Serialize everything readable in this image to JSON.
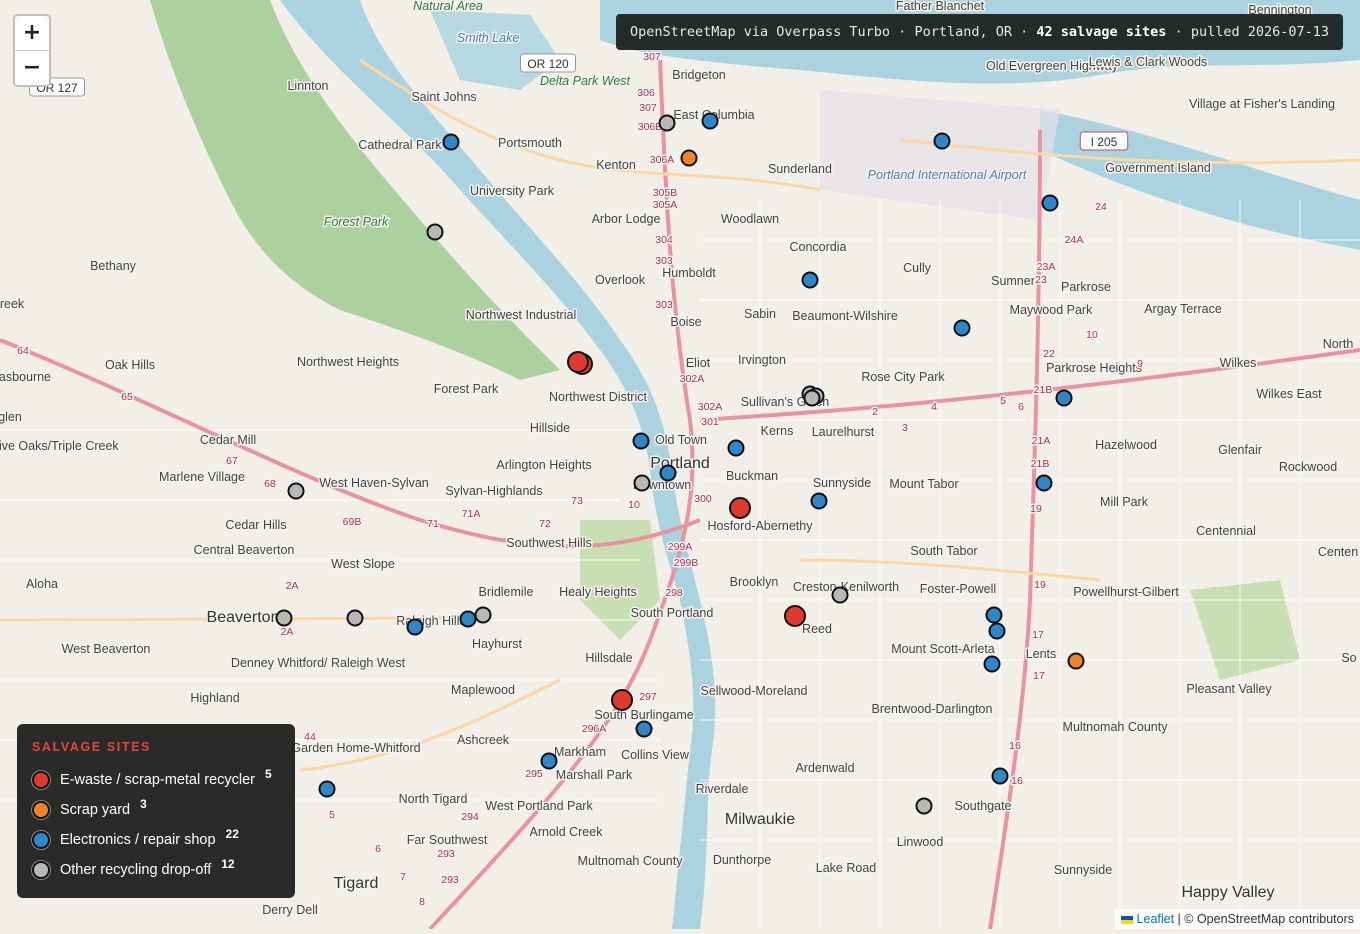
{
  "map": {
    "zoom_in_label": "+",
    "zoom_out_label": "−",
    "place_labels": [
      {
        "text": "Father Blanchet",
        "kind": "place"
      },
      {
        "text": "Bennington",
        "kind": "place"
      },
      {
        "text": "Old Evergreen Highway",
        "kind": "place"
      },
      {
        "text": "Lewis & Clark Woods",
        "kind": "place"
      },
      {
        "text": "Village at Fisher's Landing",
        "kind": "place"
      },
      {
        "text": "Linnton",
        "kind": "place"
      },
      {
        "text": "Saint Johns",
        "kind": "place"
      },
      {
        "text": "Bridgeton",
        "kind": "place"
      },
      {
        "text": "East Columbia",
        "kind": "place"
      },
      {
        "text": "Cathedral Park",
        "kind": "place"
      },
      {
        "text": "Portsmouth",
        "kind": "place"
      },
      {
        "text": "Kenton",
        "kind": "place"
      },
      {
        "text": "Sunderland",
        "kind": "place"
      },
      {
        "text": "University Park",
        "kind": "place"
      },
      {
        "text": "Arbor Lodge",
        "kind": "place"
      },
      {
        "text": "Woodlawn",
        "kind": "place"
      },
      {
        "text": "Concordia",
        "kind": "place"
      },
      {
        "text": "Cully",
        "kind": "place"
      },
      {
        "text": "Sumner",
        "kind": "place"
      },
      {
        "text": "Parkrose",
        "kind": "place"
      },
      {
        "text": "Argay Terrace",
        "kind": "place"
      },
      {
        "text": "Maywood Park",
        "kind": "place"
      },
      {
        "text": "Bethany",
        "kind": "place"
      },
      {
        "text": "Overlook",
        "kind": "place"
      },
      {
        "text": "Humboldt",
        "kind": "place"
      },
      {
        "text": "Boise",
        "kind": "place"
      },
      {
        "text": "Sabin",
        "kind": "place"
      },
      {
        "text": "Beaumont-Wilshire",
        "kind": "place"
      },
      {
        "text": "Northwest Industrial",
        "kind": "place"
      },
      {
        "text": "Northwest Heights",
        "kind": "place"
      },
      {
        "text": "Oak Hills",
        "kind": "place"
      },
      {
        "text": "Eliot",
        "kind": "place"
      },
      {
        "text": "Irvington",
        "kind": "place"
      },
      {
        "text": "Rose City Park",
        "kind": "place"
      },
      {
        "text": "Parkrose Heights",
        "kind": "place"
      },
      {
        "text": "Wilkes",
        "kind": "place"
      },
      {
        "text": "North",
        "kind": "place"
      },
      {
        "text": "Forest Park",
        "kind": "place"
      },
      {
        "text": "Northwest District",
        "kind": "place"
      },
      {
        "text": "Sullivan's Gulch",
        "kind": "place"
      },
      {
        "text": "Wilkes East",
        "kind": "place"
      },
      {
        "text": "Cedar Mill",
        "kind": "place"
      },
      {
        "text": "Five Oaks/Triple Creek",
        "kind": "place"
      },
      {
        "text": "Hillside",
        "kind": "place"
      },
      {
        "text": "Old Town",
        "kind": "place"
      },
      {
        "text": "Kerns",
        "kind": "place"
      },
      {
        "text": "Laurelhurst",
        "kind": "place"
      },
      {
        "text": "Hazelwood",
        "kind": "place"
      },
      {
        "text": "Glenfair",
        "kind": "place"
      },
      {
        "text": "Rockwood",
        "kind": "place"
      },
      {
        "text": "Marlene Village",
        "kind": "place"
      },
      {
        "text": "West Haven-Sylvan",
        "kind": "place"
      },
      {
        "text": "Arlington Heights",
        "kind": "place"
      },
      {
        "text": "Portland",
        "kind": "city"
      },
      {
        "text": "Downtown",
        "kind": "place"
      },
      {
        "text": "Buckman",
        "kind": "place"
      },
      {
        "text": "Sunnyside",
        "kind": "place"
      },
      {
        "text": "Mount Tabor",
        "kind": "place"
      },
      {
        "text": "Mill Park",
        "kind": "place"
      },
      {
        "text": "Sylvan-Highlands",
        "kind": "place"
      },
      {
        "text": "Cedar Hills",
        "kind": "place"
      },
      {
        "text": "Hosford-Abernethy",
        "kind": "place"
      },
      {
        "text": "Centennial",
        "kind": "place"
      },
      {
        "text": "Southwest Hills",
        "kind": "place"
      },
      {
        "text": "Central Beaverton",
        "kind": "place"
      },
      {
        "text": "South Tabor",
        "kind": "place"
      },
      {
        "text": "Centen",
        "kind": "place"
      },
      {
        "text": "West Slope",
        "kind": "place"
      },
      {
        "text": "Brooklyn",
        "kind": "place"
      },
      {
        "text": "Creston-Kenilworth",
        "kind": "place"
      },
      {
        "text": "Foster-Powell",
        "kind": "place"
      },
      {
        "text": "Powellhurst-Gilbert",
        "kind": "place"
      },
      {
        "text": "Aloha",
        "kind": "place"
      },
      {
        "text": "Bridlemile",
        "kind": "place"
      },
      {
        "text": "Healy Heights",
        "kind": "place"
      },
      {
        "text": "Beaverton",
        "kind": "city"
      },
      {
        "text": "South Portland",
        "kind": "place"
      },
      {
        "text": "Raleigh Hills",
        "kind": "place"
      },
      {
        "text": "Reed",
        "kind": "place"
      },
      {
        "text": "Mount Scott-Arleta",
        "kind": "place"
      },
      {
        "text": "Lents",
        "kind": "place"
      },
      {
        "text": "So",
        "kind": "place"
      },
      {
        "text": "West Beaverton",
        "kind": "place"
      },
      {
        "text": "Hayhurst",
        "kind": "place"
      },
      {
        "text": "Denney Whitford/ Raleigh West",
        "kind": "place"
      },
      {
        "text": "Hillsdale",
        "kind": "place"
      },
      {
        "text": "Pleasant Valley",
        "kind": "place"
      },
      {
        "text": "Maplewood",
        "kind": "place"
      },
      {
        "text": "Sellwood-Moreland",
        "kind": "place"
      },
      {
        "text": "Highland",
        "kind": "place"
      },
      {
        "text": "South Burlingame",
        "kind": "place"
      },
      {
        "text": "Brentwood-Darlington",
        "kind": "place"
      },
      {
        "text": "Garden Home-Whitford",
        "kind": "place"
      },
      {
        "text": "Ashcreek",
        "kind": "place"
      },
      {
        "text": "Markham",
        "kind": "place"
      },
      {
        "text": "Collins View",
        "kind": "place"
      },
      {
        "text": "Multnomah County",
        "kind": "place"
      },
      {
        "text": "Ardenwald",
        "kind": "place"
      },
      {
        "text": "Marshall Park",
        "kind": "place"
      },
      {
        "text": "Riverdale",
        "kind": "place"
      },
      {
        "text": "North Tigard",
        "kind": "place"
      },
      {
        "text": "West Portland Park",
        "kind": "place"
      },
      {
        "text": "Milwaukie",
        "kind": "city"
      },
      {
        "text": "Southgate",
        "kind": "place"
      },
      {
        "text": "Arnold Creek",
        "kind": "place"
      },
      {
        "text": "Far Southwest",
        "kind": "place"
      },
      {
        "text": "Linwood",
        "kind": "place"
      },
      {
        "text": "Multnomah County",
        "kind": "place"
      },
      {
        "text": "Dunthorpe",
        "kind": "place"
      },
      {
        "text": "Lake Road",
        "kind": "place"
      },
      {
        "text": "Sunnyside",
        "kind": "place"
      },
      {
        "text": "Tigard",
        "kind": "city"
      },
      {
        "text": "Happy Valley",
        "kind": "city"
      },
      {
        "text": "Derry Dell",
        "kind": "place"
      },
      {
        "text": "Government Island",
        "kind": "place"
      },
      {
        "text": "Portland International Airport",
        "kind": "water"
      },
      {
        "text": "Forest Park",
        "kind": "park"
      },
      {
        "text": "Delta Park West",
        "kind": "park"
      },
      {
        "text": "Smith Lake",
        "kind": "water"
      },
      {
        "text": "Natural Area",
        "kind": "park"
      },
      {
        "text": "anasbourne",
        "kind": "place"
      },
      {
        "text": "reek",
        "kind": "place"
      },
      {
        "text": "glen",
        "kind": "place"
      }
    ],
    "shields": [
      "OR 120",
      "OR 127",
      "I 205"
    ],
    "exit_labels": [
      "307",
      "306",
      "307",
      "306B",
      "306A",
      "305B",
      "305A",
      "304",
      "303",
      "303",
      "302A",
      "301",
      "302A",
      "300",
      "299A",
      "299B",
      "298",
      "297",
      "296A",
      "295",
      "294",
      "293",
      "293",
      "24",
      "24A",
      "23A",
      "23",
      "22",
      "21B",
      "21A",
      "21B",
      "19",
      "19",
      "17",
      "17",
      "16",
      "16",
      "69B",
      "68",
      "67",
      "65",
      "64",
      "71",
      "71A",
      "72",
      "73",
      "10",
      "9",
      "10",
      "5",
      "6",
      "2",
      "3",
      "4",
      "2A",
      "2A",
      "44",
      "5",
      "6",
      "7",
      "8"
    ]
  },
  "banner": {
    "source": "OpenStreetMap via Overpass Turbo",
    "sep": " · ",
    "place": "Portland, OR",
    "count": "42 salvage sites",
    "pulled": "pulled 2026-07-13"
  },
  "legend": {
    "title": "SALVAGE SITES",
    "items": [
      {
        "label": "E-waste / scrap-metal recycler",
        "count": "5",
        "color": "#e03a2f"
      },
      {
        "label": "Scrap yard",
        "count": "3",
        "color": "#f0822a"
      },
      {
        "label": "Electronics / repair shop",
        "count": "22",
        "color": "#2f86c8"
      },
      {
        "label": "Other recycling drop-off",
        "count": "12",
        "color": "#b8b8b8"
      }
    ]
  },
  "attribution": {
    "leaflet": "Leaflet",
    "sep": " | ",
    "osm": "© OpenStreetMap contributors"
  }
}
